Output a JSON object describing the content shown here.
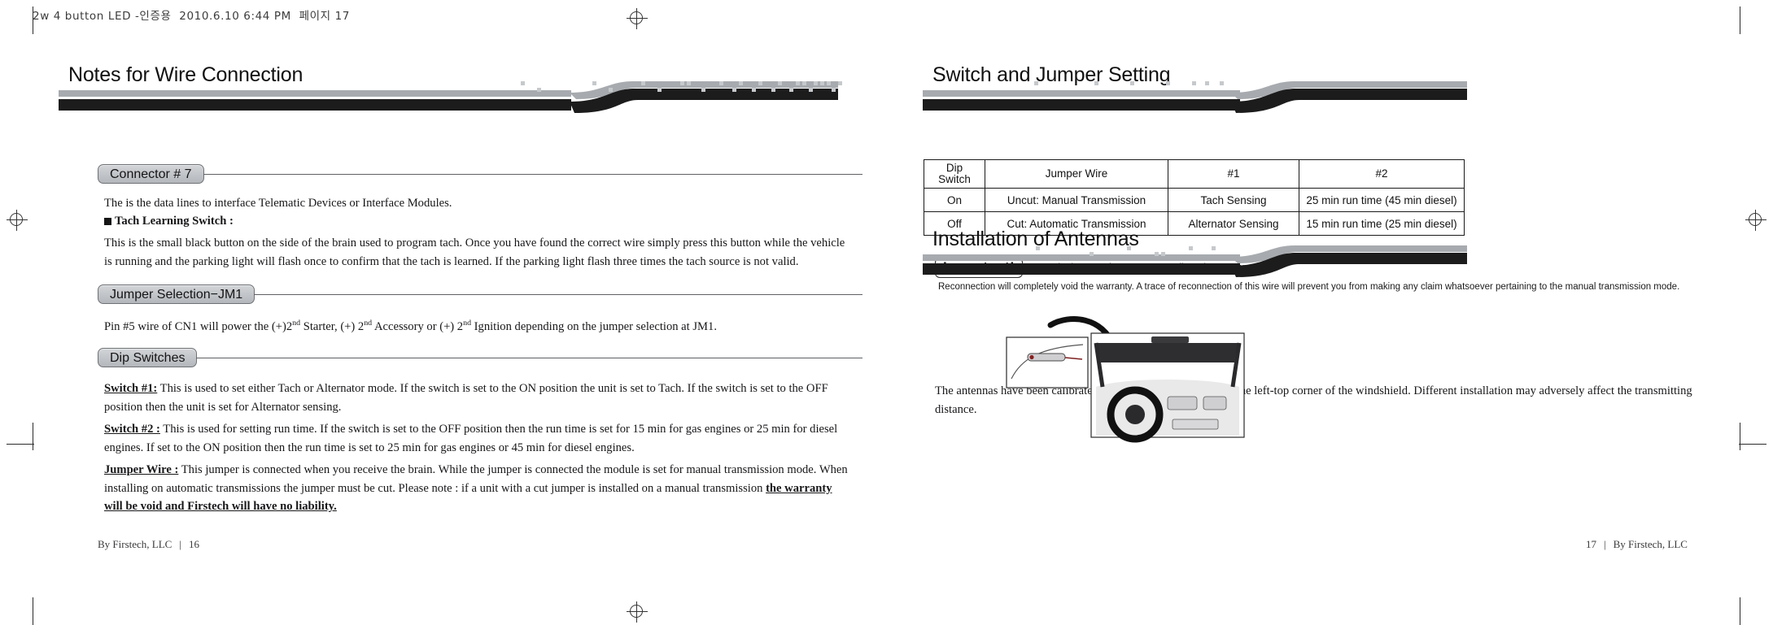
{
  "scan": {
    "header_line": "2w 4 button LED -인증용  2010.6.10 6:44 PM  페이지 17"
  },
  "left_page": {
    "banner_title": "Notes for Wire Connection",
    "sections": [
      {
        "pill": "Connector # 7",
        "paragraphs": [
          "The is the data lines to interface Telematic Devices or Interface Modules.",
          "Tach Learning  Switch :",
          "This is the small black button on the side of the brain used to program tach.  Once you have found the correct wire simply press this button while the vehicle is running and the parking light will flash once to confirm that the tach is learned.  If the parking light flash three times the tach source is not valid."
        ]
      },
      {
        "pill": "Jumper Selection−JM1",
        "paragraph_pin": {
          "part1": "Pin #5 wire of CN1 will power the (+)2",
          "ord1": "nd",
          "part2": " Starter, (+) 2",
          "ord2": "nd",
          "part3": " Accessory or (+) 2",
          "ord3": "nd",
          "part4": "  Ignition depending on the jumper selection at JM1."
        }
      },
      {
        "pill": "Dip Switches",
        "switch1_label": "Switch #1:",
        "switch1_text": " This is used to set either Tach or Alternator mode.  If the switch is set to the ON position the unit is set to Tach.  If the switch is set to the OFF position then the unit is set for Alternator sensing.",
        "switch2_label": "Switch #2 :",
        "switch2_text": " This is used for setting run time.  If the switch is set to the OFF position then the run time is set for 15 min for gas engines or 25 min for diesel engines.  If set to the ON position then the run time is set to 25 min for gas engines   or 45 min for diesel engines.",
        "jumper_label": "Jumper Wire :",
        "jumper_text": " This jumper is connected when you receive the brain. While the jumper is connected  the module is set for manual transmission mode. When installing on automatic transmissions the jumper must be cut.  Please note : if a unit with a cut jumper is installed on a manual transmission ",
        "jumper_bold_tail": "the warranty will be void and Firstech will have no liability."
      }
    ],
    "footer": {
      "company": "By Firstech, LLC",
      "page_number": "16"
    }
  },
  "right_page": {
    "banner_title_1": "Switch and Jumper Setting",
    "table": {
      "headers": [
        "Dip\nSwitch",
        "Jumper Wire",
        "#1",
        "#2"
      ],
      "header_dip_line1": "Dip",
      "header_dip_line2": "Switch",
      "header_jumper": "Jumper Wire",
      "header_1": "#1",
      "header_2": "#2",
      "rows": [
        [
          "On",
          "Uncut: Manual Transmission",
          "Tach Sensing",
          "25 min run time (45 min diesel)"
        ],
        [
          "Off",
          "Cut: Automatic Transmission",
          "Alternator Sensing",
          "15 min run time (25 min diesel)"
        ]
      ]
    },
    "important": {
      "badge": "Important!",
      "line1": "you cut the jumper wire, you are not allowed to reconnect it.",
      "line2": "Reconnection will completely void the warranty. A trace of reconnection of this wire will prevent you from making any claim whatsoever pertaining to the manual transmission mode."
    },
    "banner_title_2": "Installation of Antennas",
    "antenna_text": "The antennas have been calibrated for horizontal installation at the left-top corner of the windshield.  Different installation  may adversely affect the transmitting distance.",
    "footer": {
      "company": "By Firstech, LLC",
      "page_number": "17"
    }
  },
  "colors": {
    "bar_gray": "#a7abaf",
    "bar_black": "#1c1c1c",
    "pill_face": "#c3c6ca",
    "ink": "#17171a"
  }
}
